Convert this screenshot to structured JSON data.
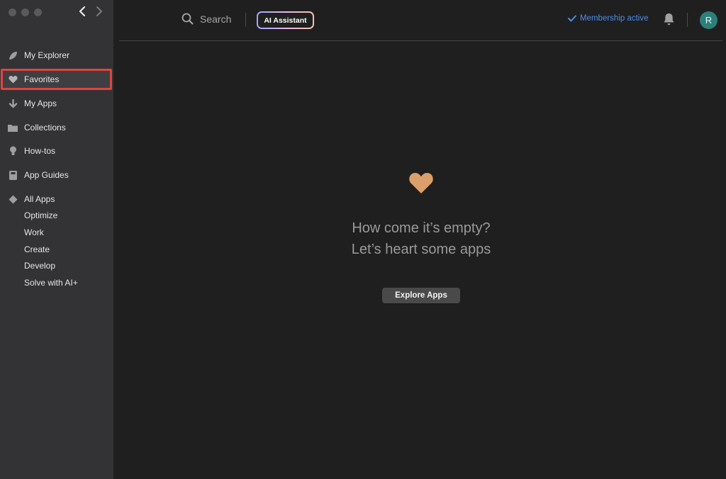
{
  "sidebar": {
    "items": [
      {
        "label": "My Explorer",
        "icon": "leaf-icon"
      },
      {
        "label": "Favorites",
        "icon": "heart-icon"
      },
      {
        "label": "My Apps",
        "icon": "download-arrow-icon"
      },
      {
        "label": "Collections",
        "icon": "folder-icon"
      },
      {
        "label": "How-tos",
        "icon": "lightbulb-icon"
      },
      {
        "label": "App Guides",
        "icon": "book-icon"
      },
      {
        "label": "All Apps",
        "icon": "diamond-icon"
      }
    ],
    "sub_items": [
      "Optimize",
      "Work",
      "Create",
      "Develop",
      "Solve with AI+"
    ],
    "selected": "Favorites"
  },
  "header": {
    "search_label": "Search",
    "ai_button_label": "AI Assistant",
    "membership_label": "Membership active",
    "avatar_initial": "R"
  },
  "main": {
    "empty_line_1": "How come it’s empty?",
    "empty_line_2": "Let’s heart some apps",
    "explore_button_label": "Explore Apps"
  },
  "colors": {
    "sidebar_bg": "#333336",
    "main_bg": "#1f1f1f",
    "highlight_border": "#e0443e",
    "accent_blue": "#4b8de8",
    "heart": "#dba06a",
    "avatar_bg": "#2c7f7a"
  }
}
